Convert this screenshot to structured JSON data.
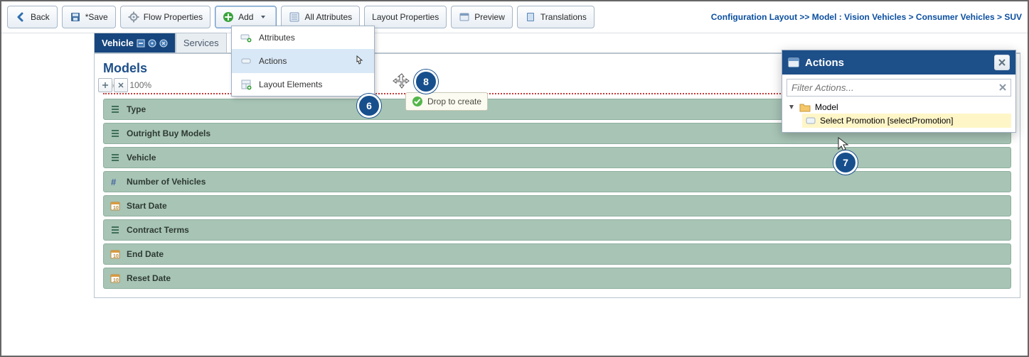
{
  "toolbar": {
    "back": "Back",
    "save": "*Save",
    "flow_props": "Flow Properties",
    "add": "Add",
    "all_attrs": "All Attributes",
    "layout_props": "Layout Properties",
    "preview": "Preview",
    "translations": "Translations"
  },
  "breadcrumb": "Configuration Layout >> Model : Vision Vehicles > Consumer Vehicles > SUV",
  "add_menu": {
    "attributes": "Attributes",
    "actions": "Actions",
    "layout_elements": "Layout Elements"
  },
  "tabs": {
    "vehicle": "Vehicle",
    "services": "Services"
  },
  "panel": {
    "title": "Models",
    "width_label": "Width: 100%"
  },
  "rows": [
    "Type",
    "Outright Buy Models",
    "Vehicle",
    "Number of Vehicles",
    "Start Date",
    "Contract Terms",
    "End Date",
    "Reset Date"
  ],
  "drop_tip": "Drop to create",
  "dialog": {
    "title": "Actions",
    "filter_placeholder": "Filter Actions...",
    "tree_root": "Model",
    "tree_item": "Select Promotion [selectPromotion]"
  },
  "callouts": {
    "six": "6",
    "seven": "7",
    "eight": "8"
  },
  "colors": {
    "accent": "#1e4f8a",
    "row_green": "#a7c4b5",
    "dialog_header": "#1d4f88"
  }
}
